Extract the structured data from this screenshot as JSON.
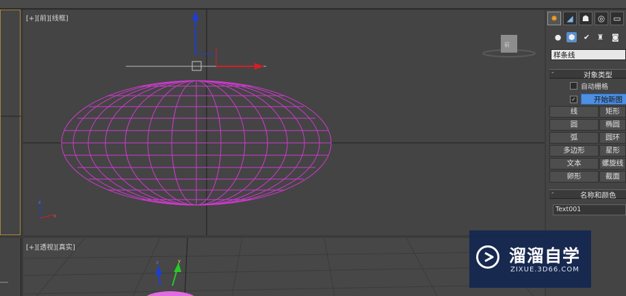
{
  "viewports": {
    "front": {
      "label": "[+][前][线框]"
    },
    "perspective": {
      "label": "[+][透视][真实]"
    }
  },
  "command_panel": {
    "tabs": [
      "create-tab",
      "modify-tab",
      "hierarchy-tab",
      "motion-tab",
      "display-tab"
    ],
    "sub_icons": [
      "geometry-icon",
      "shapes-icon",
      "lights-icon",
      "cameras-icon",
      "helpers-icon"
    ],
    "category_dropdown": "样条线",
    "object_type": {
      "title": "对象类型",
      "auto_grid": "自动栅格",
      "start_new_shape": "开始新图",
      "buttons": [
        [
          "线",
          "矩形"
        ],
        [
          "圆",
          "椭圆"
        ],
        [
          "弧",
          "圆环"
        ],
        [
          "多边形",
          "星形"
        ],
        [
          "文本",
          "螺旋线"
        ],
        [
          "卵形",
          "截面"
        ]
      ]
    },
    "name_color": {
      "title": "名称和颜色",
      "name_value": "Text001"
    }
  },
  "watermark": {
    "title": "溜溜自学",
    "url": "ZIXUE.3D66.COM"
  },
  "colors": {
    "spline": "#d23ad2",
    "x_axis": "#d42020",
    "y_axis": "#1b3ed8",
    "z_axis": "#28c828",
    "start_button": "#4d8fe0",
    "watermark_bg": "#122652"
  }
}
